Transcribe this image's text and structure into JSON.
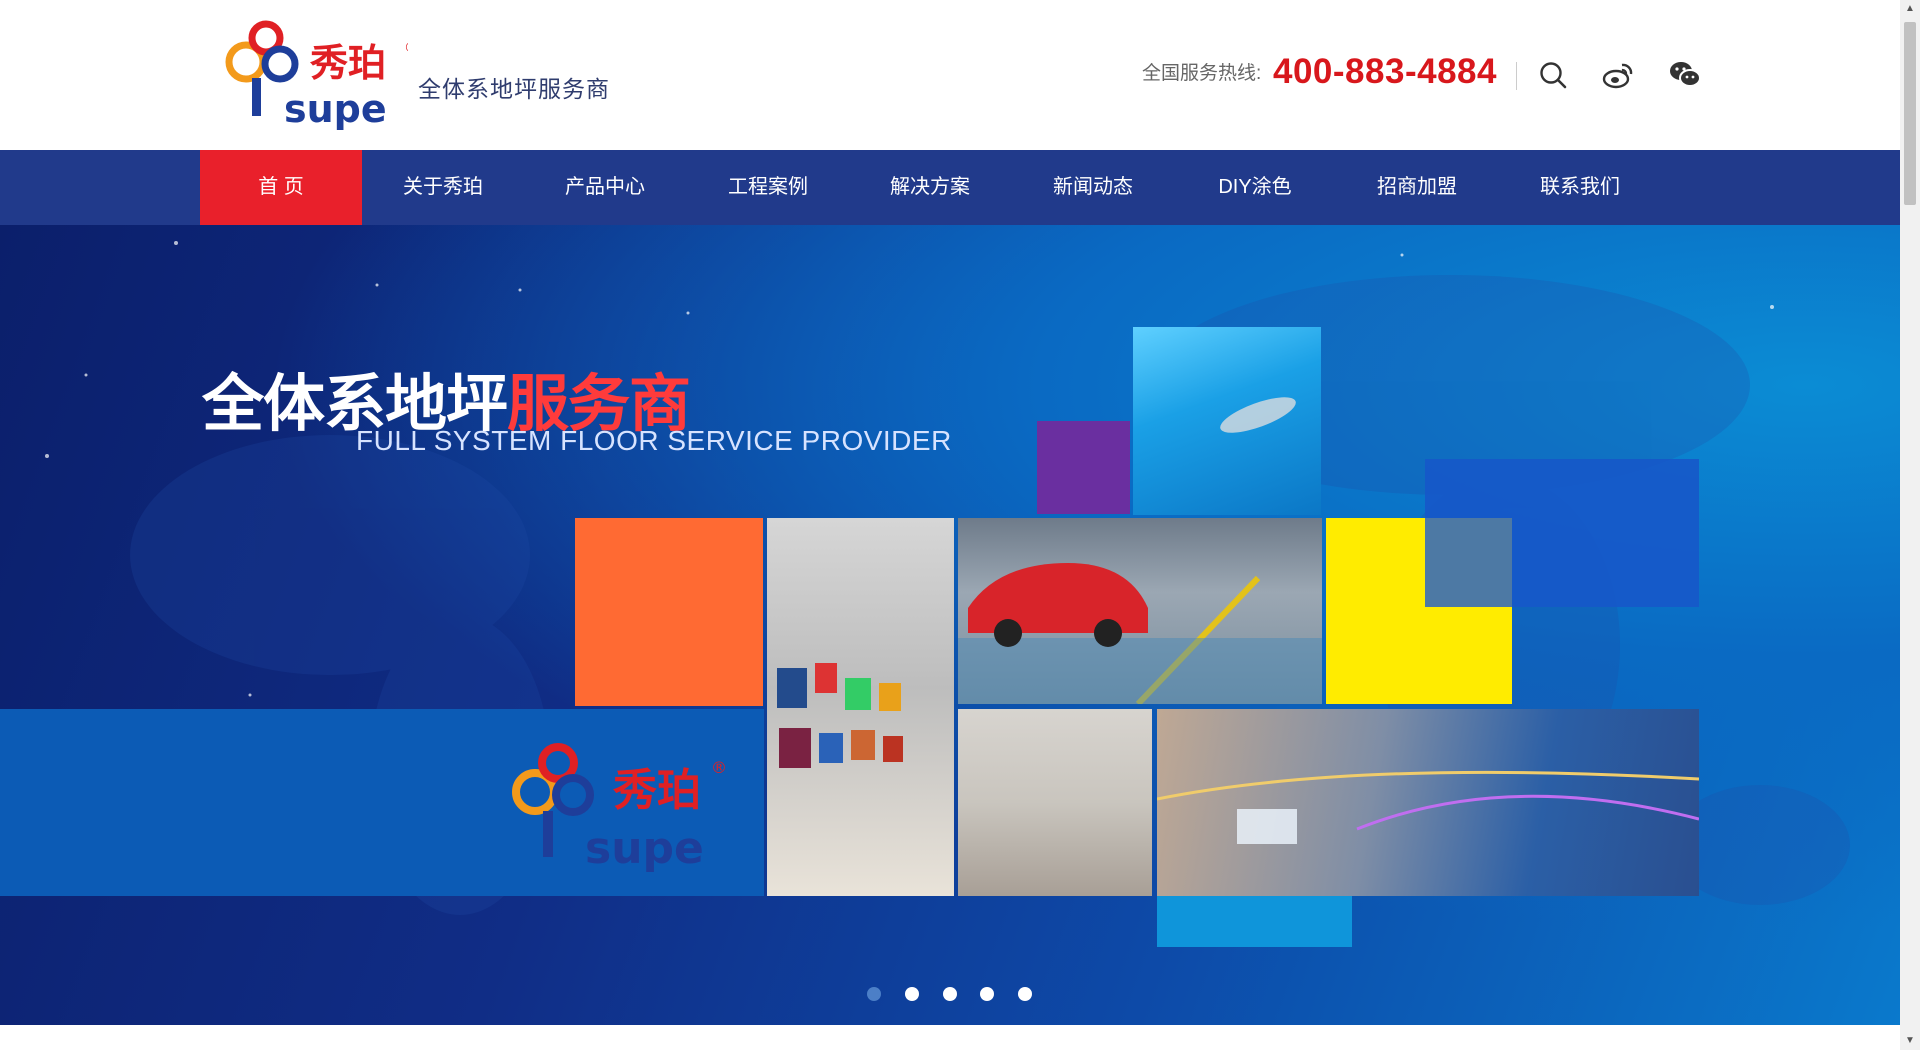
{
  "brand": {
    "logo_cn": "秀珀",
    "logo_en": "supe",
    "registered": "®",
    "tagline": "全体系地坪服务商"
  },
  "contact": {
    "hotline_label": "全国服务热线:",
    "phone": "400-883-4884"
  },
  "header_icons": [
    "search-icon",
    "weibo-icon",
    "wechat-icon"
  ],
  "nav": {
    "items": [
      {
        "label": "首 页",
        "active": true
      },
      {
        "label": "关于秀珀",
        "active": false
      },
      {
        "label": "产品中心",
        "active": false
      },
      {
        "label": "工程案例",
        "active": false
      },
      {
        "label": "解决方案",
        "active": false
      },
      {
        "label": "新闻动态",
        "active": false
      },
      {
        "label": "DIY涂色",
        "active": false
      },
      {
        "label": "招商加盟",
        "active": false
      },
      {
        "label": "联系我们",
        "active": false
      }
    ]
  },
  "banner": {
    "headline_white": "全体系地坪",
    "headline_red": "服务商",
    "subline": "FULL SYSTEM FLOOR SERVICE PROVIDER",
    "slide_count": 5,
    "active_slide": 1
  },
  "colors": {
    "nav_bg": "#213a8b",
    "active_nav": "#e9202b",
    "phone": "#d8171c",
    "accent_orange": "#ff6a33",
    "accent_yellow": "#ffec00",
    "accent_purple": "#6a2fa0"
  }
}
